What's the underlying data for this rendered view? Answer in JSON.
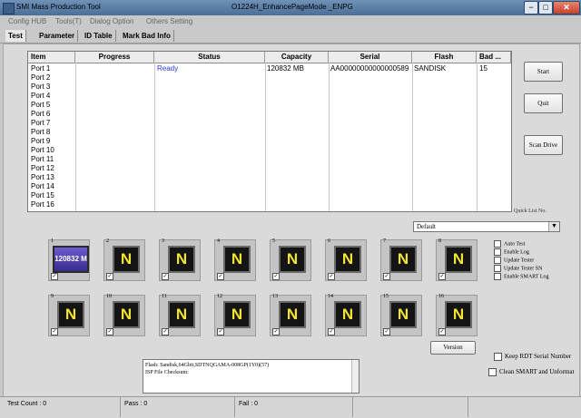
{
  "window": {
    "title": "SMI Mass Production Tool",
    "mode": "O1224H_EnhancePageMode      _ENPG",
    "min_glyph": "−",
    "max_glyph": "□",
    "close_glyph": "✕"
  },
  "menu": [
    "Config HUB",
    "Tools(T)",
    "Dialog Option",
    "Others Setting"
  ],
  "tabs": [
    "Test",
    "Parameter",
    "ID Table",
    "Mark Bad Info"
  ],
  "grid": {
    "columns": [
      "Item",
      "Progress",
      "Status",
      "Capacity",
      "Serial",
      "Flash",
      "Bad ..."
    ],
    "rows": [
      {
        "item": "Port 1",
        "progress": "",
        "status": "Ready",
        "capacity": "120832 MB",
        "serial": "AA00000000000000589",
        "flash": "SANDISK",
        "bad": "15"
      },
      {
        "item": "Port 2",
        "progress": "",
        "status": "",
        "capacity": "",
        "serial": "",
        "flash": "",
        "bad": ""
      },
      {
        "item": "Port 3",
        "progress": "",
        "status": "",
        "capacity": "",
        "serial": "",
        "flash": "",
        "bad": ""
      },
      {
        "item": "Port 4",
        "progress": "",
        "status": "",
        "capacity": "",
        "serial": "",
        "flash": "",
        "bad": ""
      },
      {
        "item": "Port 5",
        "progress": "",
        "status": "",
        "capacity": "",
        "serial": "",
        "flash": "",
        "bad": ""
      },
      {
        "item": "Port 6",
        "progress": "",
        "status": "",
        "capacity": "",
        "serial": "",
        "flash": "",
        "bad": ""
      },
      {
        "item": "Port 7",
        "progress": "",
        "status": "",
        "capacity": "",
        "serial": "",
        "flash": "",
        "bad": ""
      },
      {
        "item": "Port 8",
        "progress": "",
        "status": "",
        "capacity": "",
        "serial": "",
        "flash": "",
        "bad": ""
      },
      {
        "item": "Port 9",
        "progress": "",
        "status": "",
        "capacity": "",
        "serial": "",
        "flash": "",
        "bad": ""
      },
      {
        "item": "Port 10",
        "progress": "",
        "status": "",
        "capacity": "",
        "serial": "",
        "flash": "",
        "bad": ""
      },
      {
        "item": "Port 11",
        "progress": "",
        "status": "",
        "capacity": "",
        "serial": "",
        "flash": "",
        "bad": ""
      },
      {
        "item": "Port 12",
        "progress": "",
        "status": "",
        "capacity": "",
        "serial": "",
        "flash": "",
        "bad": ""
      },
      {
        "item": "Port 13",
        "progress": "",
        "status": "",
        "capacity": "",
        "serial": "",
        "flash": "",
        "bad": ""
      },
      {
        "item": "Port 14",
        "progress": "",
        "status": "",
        "capacity": "",
        "serial": "",
        "flash": "",
        "bad": ""
      },
      {
        "item": "Port 15",
        "progress": "",
        "status": "",
        "capacity": "",
        "serial": "",
        "flash": "",
        "bad": ""
      },
      {
        "item": "Port 16",
        "progress": "",
        "status": "",
        "capacity": "",
        "serial": "",
        "flash": "",
        "bad": ""
      }
    ]
  },
  "buttons": {
    "start": "Start",
    "quit": "Quit",
    "scan": "Scan Drive",
    "version": "Version"
  },
  "quick_list": {
    "label": "Quick List No.",
    "value": "Default",
    "arrow": "▼"
  },
  "ports": [
    {
      "num": "1",
      "label": "120832 M",
      "active": true
    },
    {
      "num": "2",
      "label": "N",
      "active": false
    },
    {
      "num": "3",
      "label": "N",
      "active": false
    },
    {
      "num": "4",
      "label": "N",
      "active": false
    },
    {
      "num": "5",
      "label": "N",
      "active": false
    },
    {
      "num": "6",
      "label": "N",
      "active": false
    },
    {
      "num": "7",
      "label": "N",
      "active": false
    },
    {
      "num": "8",
      "label": "N",
      "active": false
    },
    {
      "num": "9",
      "label": "N",
      "active": false
    },
    {
      "num": "10",
      "label": "N",
      "active": false
    },
    {
      "num": "11",
      "label": "N",
      "active": false
    },
    {
      "num": "12",
      "label": "N",
      "active": false
    },
    {
      "num": "13",
      "label": "N",
      "active": false
    },
    {
      "num": "14",
      "label": "N",
      "active": false
    },
    {
      "num": "15",
      "label": "N",
      "active": false
    },
    {
      "num": "16",
      "label": "N",
      "active": false
    }
  ],
  "options": [
    "Auto Test",
    "Enable Log",
    "Update Tester",
    "Update Tester SN",
    "Enable SMART Log"
  ],
  "keep_rdt": "Keep RDT Serial Number",
  "clean_smart": "Clean SMART and Unformat",
  "info": {
    "line1": "Flash: Sandisk,64Gbit,SDTNQGAMA-008GP(1Y0)(57)",
    "line2": "ISP File Checksum:"
  },
  "status": {
    "test_count": "Test Count : 0",
    "pass": "Pass : 0",
    "fail": "Fail : 0"
  },
  "colors": {
    "status_ready": "#2b3bd8",
    "tile_active": "#4a3cb0",
    "n_letter": "#f2e430"
  }
}
